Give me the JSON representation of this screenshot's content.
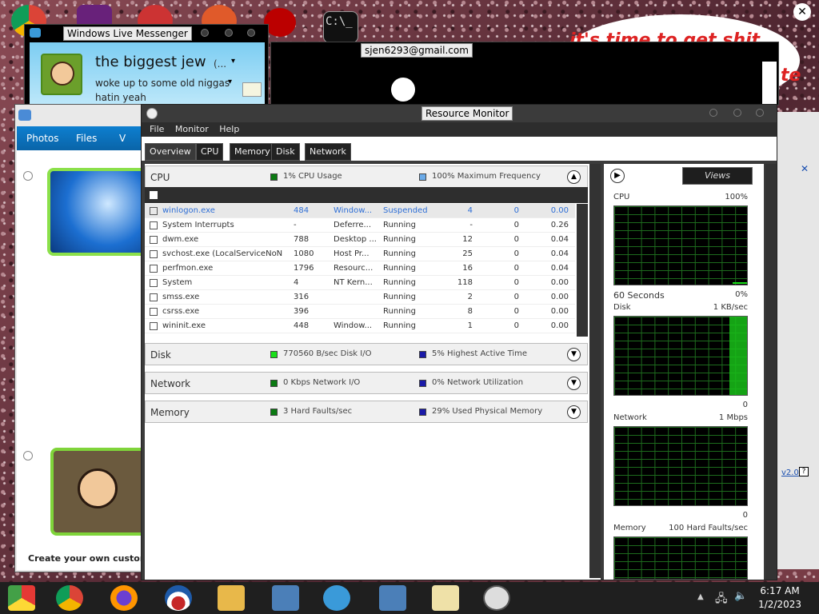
{
  "messenger": {
    "title": "Windows Live Messenger",
    "name": "the biggest jew",
    "name_suffix": "(...",
    "status_message_1": "woke up to some old niggas",
    "status_message_2": "hatin yeah"
  },
  "mid_window": {
    "email": "sjen6293@gmail.com"
  },
  "banner_text": "it's time to get shit",
  "banner_text_2": "te",
  "photos": {
    "tabs": [
      "Photos",
      "Files",
      "V"
    ],
    "footer": "Create your own custom"
  },
  "resmon": {
    "title": "Resource Monitor",
    "menu": [
      "File",
      "Monitor",
      "Help"
    ],
    "tabs": [
      "Overview",
      "CPU",
      "Memory",
      "Disk",
      "Network"
    ],
    "cpu": {
      "name": "CPU",
      "usage": "1% CPU Usage",
      "freq": "100% Maximum Frequency"
    },
    "processes": [
      {
        "image": "winlogon.exe",
        "pid": "484",
        "desc": "Window...",
        "status": "Suspended",
        "threads": "4",
        "cpu": "0",
        "avg": "0.00"
      },
      {
        "image": "System Interrupts",
        "pid": "-",
        "desc": "Deferre...",
        "status": "Running",
        "threads": "-",
        "cpu": "0",
        "avg": "0.26"
      },
      {
        "image": "dwm.exe",
        "pid": "788",
        "desc": "Desktop ...",
        "status": "Running",
        "threads": "12",
        "cpu": "0",
        "avg": "0.04"
      },
      {
        "image": "svchost.exe (LocalServiceNoNe...",
        "pid": "1080",
        "desc": "Host Pr...",
        "status": "Running",
        "threads": "25",
        "cpu": "0",
        "avg": "0.04"
      },
      {
        "image": "perfmon.exe",
        "pid": "1796",
        "desc": "Resourc...",
        "status": "Running",
        "threads": "16",
        "cpu": "0",
        "avg": "0.04"
      },
      {
        "image": "System",
        "pid": "4",
        "desc": "NT Kern...",
        "status": "Running",
        "threads": "118",
        "cpu": "0",
        "avg": "0.00"
      },
      {
        "image": "smss.exe",
        "pid": "316",
        "desc": "",
        "status": "Running",
        "threads": "2",
        "cpu": "0",
        "avg": "0.00"
      },
      {
        "image": "csrss.exe",
        "pid": "396",
        "desc": "",
        "status": "Running",
        "threads": "8",
        "cpu": "0",
        "avg": "0.00"
      },
      {
        "image": "wininit.exe",
        "pid": "448",
        "desc": "Window...",
        "status": "Running",
        "threads": "1",
        "cpu": "0",
        "avg": "0.00"
      }
    ],
    "disk": {
      "name": "Disk",
      "io": "770560 B/sec Disk I/O",
      "active": "5% Highest Active Time"
    },
    "network": {
      "name": "Network",
      "io": "0 Kbps Network I/O",
      "util": "0% Network Utilization"
    },
    "memory": {
      "name": "Memory",
      "faults": "3 Hard Faults/sec",
      "used": "29% Used Physical Memory"
    },
    "views_label": "Views",
    "graphs": {
      "cpu": {
        "label": "CPU",
        "max": "100%",
        "foot_left": "60 Seconds",
        "foot_right": "0%"
      },
      "disk": {
        "label": "Disk",
        "max": "1 KB/sec",
        "foot_right": "0"
      },
      "network": {
        "label": "Network",
        "max": "1 Mbps",
        "foot_right": "0"
      },
      "memory": {
        "label": "Memory",
        "max": "100 Hard Faults/sec"
      }
    }
  },
  "right_window": {
    "version": "v2.0"
  },
  "taskbar": {
    "time": "6:17 AM",
    "date": "1/2/2023"
  },
  "colors": {
    "accent_blue": "#0d7fd0",
    "graph_green": "#1d6b1d",
    "dark_bg": "#3b3b3b"
  }
}
